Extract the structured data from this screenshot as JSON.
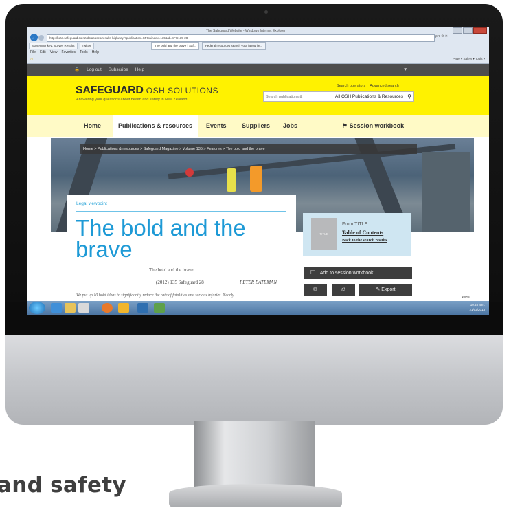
{
  "browser": {
    "window_title": "The Safeguard Website - Windows Internet Explorer",
    "address": "http://beta.safeguard.co.nz/databases/results-highway/?publication=SFG&index=135&id=SFG135-28",
    "address_tools": "ρ ▾ ⊘ ✕",
    "favorites": [
      "SurveyMonkey: Survey Results",
      "Twitter"
    ],
    "tabs": [
      {
        "label": "The bold and the brave | Saf...",
        "active": true
      },
      {
        "label": "Federal resources search your favourite...",
        "active": false
      }
    ],
    "menu": [
      "File",
      "Edit",
      "View",
      "Favorites",
      "Tools",
      "Help"
    ],
    "command_bar": "Page ▾  Safety ▾  Tools ▾"
  },
  "site": {
    "top_links": [
      "Log out",
      "Subscribe",
      "Help"
    ],
    "logo_main": "SAFEGUARD",
    "logo_secondary": "OSH SOLUTIONS",
    "logo_tagline": "Answering your questions about health and safety in New Zealand",
    "search_links": [
      "Search operators",
      "Advanced search"
    ],
    "search_placeholder": "Search publications &",
    "search_scope": "All OSH Publications & Resources",
    "nav": [
      "Home",
      "Publications & resources",
      "Events",
      "Suppliers",
      "Jobs",
      "Session workbook"
    ]
  },
  "breadcrumb": "Home  >  Publications & resources  >  Safeguard Magazine  >  Volume 135  >  Features  >  The bold and the brave",
  "article": {
    "kicker": "Legal viewpoint",
    "title": "The bold and the brave",
    "meta_title": "The bold and the brave",
    "reference": "(2012) 135 Safeguard 28",
    "author": "PETER BATEMAN",
    "abstract": "We put up 10 bold ideas to significantly reduce the rate of fatalities and serious injuries. Nearly"
  },
  "toc": {
    "thumb_text": "TITLE",
    "from": "From TITLE",
    "link": "Table of Contents",
    "back": "Back to the search results"
  },
  "actions": {
    "add_workbook": "Add to session workbook",
    "export": "Export"
  },
  "taskbar": {
    "time": "10:45 a.m.",
    "date": "21/02/2013",
    "zoom": "100%"
  },
  "promo_tagline": "and safety"
}
